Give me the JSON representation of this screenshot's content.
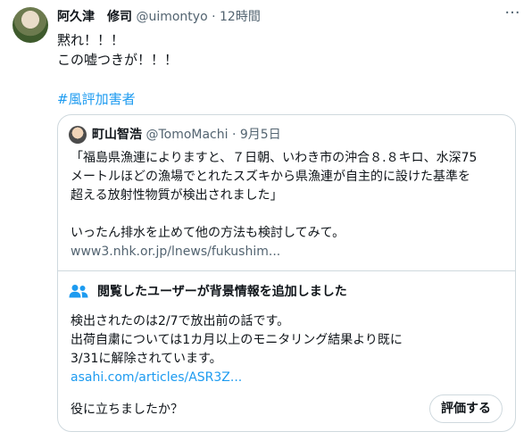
{
  "tweet": {
    "author_name": "阿久津　修司",
    "handle": "@uimontyo",
    "separator": "·",
    "time": "12時間",
    "text_lines": [
      "黙れ！！！",
      "この嘘つきが！！！"
    ],
    "hashtag": "#風評加害者"
  },
  "quote": {
    "author_name": "町山智浩",
    "handle": "@TomoMachi",
    "separator": "·",
    "date": "9月5日",
    "text_lines": [
      "「福島県漁連によりますと、７日朝、いわき市の沖合８.８キロ、水深75",
      "メートルほどの漁場でとれたスズキから県漁連が自主的に設けた基準を",
      "超える放射性物質が検出されました」",
      "",
      "いったん排水を止めて他の方法も検討してみて。",
      "www3.nhk.or.jp/lnews/fukushim..."
    ]
  },
  "community_note": {
    "title": "閲覧したユーザーが背景情報を追加しました",
    "body_lines": [
      "検出されたのは2/7で放出前の話です。",
      "出荷自粛については1カ月以上のモニタリング結果より既に",
      "3/31に解除されています。"
    ],
    "link": "asahi.com/articles/ASR3Z...",
    "helpful_question": "役に立ちましたか？",
    "rate_button": "評価する"
  },
  "colors": {
    "text": "#0f1419",
    "muted": "#536471",
    "link": "#1d9bf0",
    "border": "#cfd9de"
  }
}
